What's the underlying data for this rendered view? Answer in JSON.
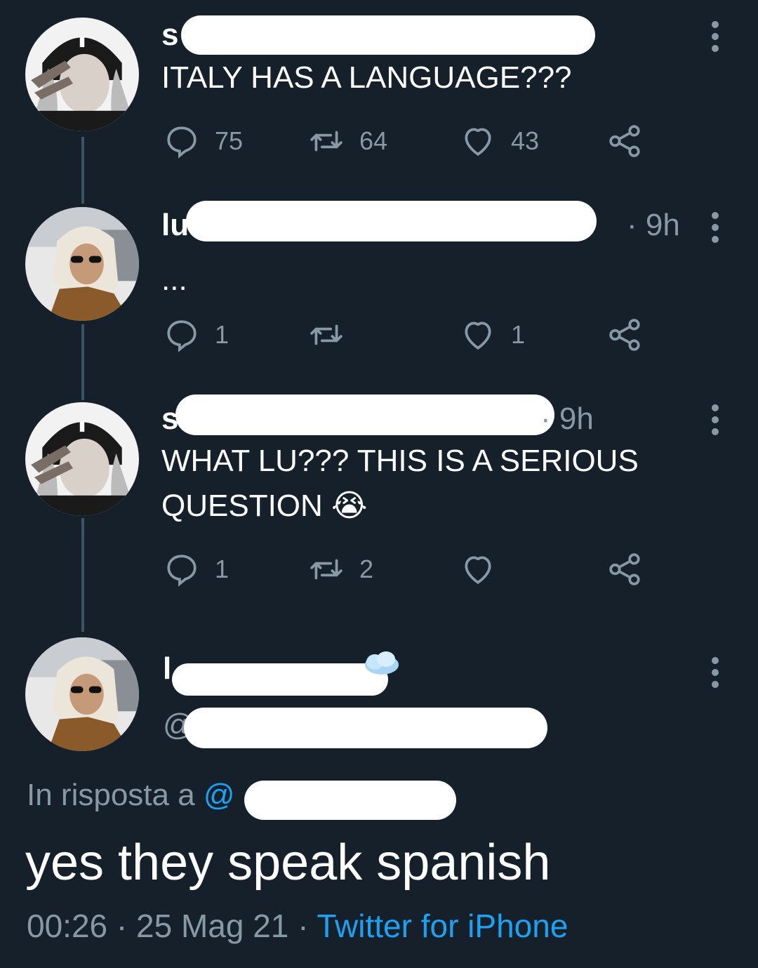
{
  "tweets": [
    {
      "name_visible": "s",
      "text": "ITALY HAS A LANGUAGE???",
      "reply_count": "75",
      "retweet_count": "64",
      "like_count": "43"
    },
    {
      "name_visible": "lu",
      "time": "· 9h",
      "text": "...",
      "reply_count": "1",
      "retweet_count": "",
      "like_count": "1"
    },
    {
      "name_visible": "s",
      "time": "· 9h",
      "text_line1": "WHAT LU??? THIS IS A SERIOUS",
      "text_line2": "QUESTION",
      "emoji": "😭",
      "reply_count": "1",
      "retweet_count": "2",
      "like_count": ""
    }
  ],
  "main_tweet": {
    "name_visible": "l",
    "handle_prefix": "@",
    "reply_prefix": "In risposta a",
    "reply_at": "@",
    "text": "yes they speak spanish",
    "time": "00:26",
    "date": "25 Mag 21",
    "source": "Twitter for iPhone",
    "sep1": "·",
    "sep2": "·"
  },
  "colors": {
    "background": "#15202b",
    "muted": "#8899a6",
    "link": "#1da1f2",
    "thread_line": "#3d5466"
  },
  "icons": [
    "reply-icon",
    "retweet-icon",
    "like-icon",
    "share-icon",
    "more-icon",
    "cloud-emoji-icon"
  ]
}
